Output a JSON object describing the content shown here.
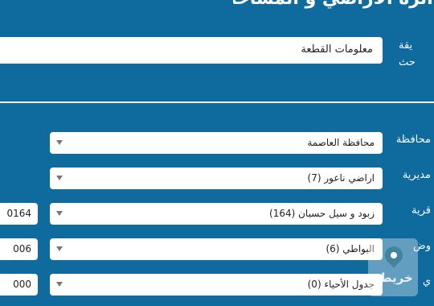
{
  "header": {
    "title": "دائرة الأراضي و المساحة"
  },
  "search": {
    "method_label": "يقة حث",
    "info_value": "معلومات القطعة"
  },
  "fields": {
    "governorate": {
      "label": "محافظة",
      "value": "محافظة العاصمة"
    },
    "directorate": {
      "label": "مديرية",
      "value": "اراضي ناعور (7)"
    },
    "village": {
      "label": "قرية",
      "value": "زبود و سيل حسبان (164)",
      "code": "0164"
    },
    "basin": {
      "label": "وض",
      "value": "البواطي (6)",
      "code": "006"
    },
    "neighborhood": {
      "label": "ي",
      "value": "جدول الأحياء (0)",
      "code": "000"
    }
  },
  "watermark": {
    "text": "خريطة"
  },
  "colors": {
    "background": "#0f6b9e",
    "box": "#ffffff"
  }
}
